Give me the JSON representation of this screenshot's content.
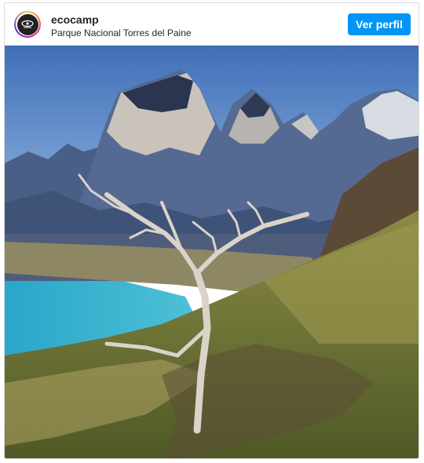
{
  "post": {
    "username": "ecocamp",
    "location": "Parque Nacional Torres del Paine",
    "profile_button_label": "Ver perfil",
    "avatar_icon": "ecocamp-logo",
    "photo_subject": "mountain-landscape-photo"
  },
  "colors": {
    "button_bg": "#0095f6",
    "button_text": "#ffffff",
    "text": "#262626"
  }
}
